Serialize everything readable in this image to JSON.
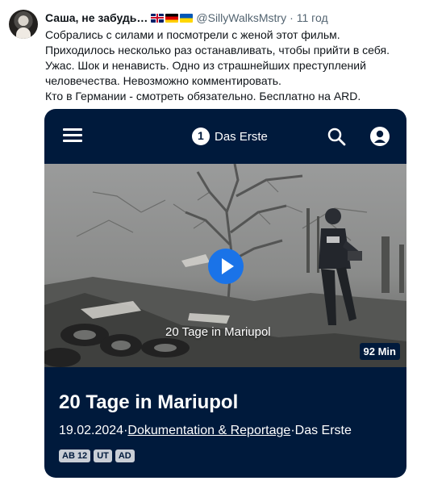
{
  "tweet": {
    "author_name": "Саша, не забудь…",
    "flags": [
      "gb-flag",
      "de-flag",
      "ua-flag"
    ],
    "handle": "@SillyWalksMstry",
    "separator": "·",
    "time": "11 год",
    "text_lines": [
      "Собрались с силами и посмотрели с женой этот фильм.",
      "Приходилось несколько раз останавливать, чтобы прийти в себя.",
      "Ужас. Шок и ненависть. Одно из страшнейших преступлений",
      "человечества. Невозможно комментировать.",
      "Кто в Германии - смотреть обязательно. Бесплатно на ARD."
    ]
  },
  "card": {
    "brand_logo": "1",
    "brand_name": "Das Erste",
    "video_caption": "20 Tage in Mariupol",
    "duration": "92 Min",
    "title": "20 Tage in Mariupol",
    "date": "19.02.2024",
    "sep": " · ",
    "category_link": "Dokumentation & Reportage",
    "channel": "Das Erste",
    "badges": [
      "AB 12",
      "UT",
      "AD"
    ],
    "colors": {
      "background": "#001a3c",
      "play": "#1a73e8",
      "badge": "#c9ced6"
    },
    "icons": [
      "menu-icon",
      "search-icon",
      "profile-icon",
      "play-icon"
    ]
  }
}
